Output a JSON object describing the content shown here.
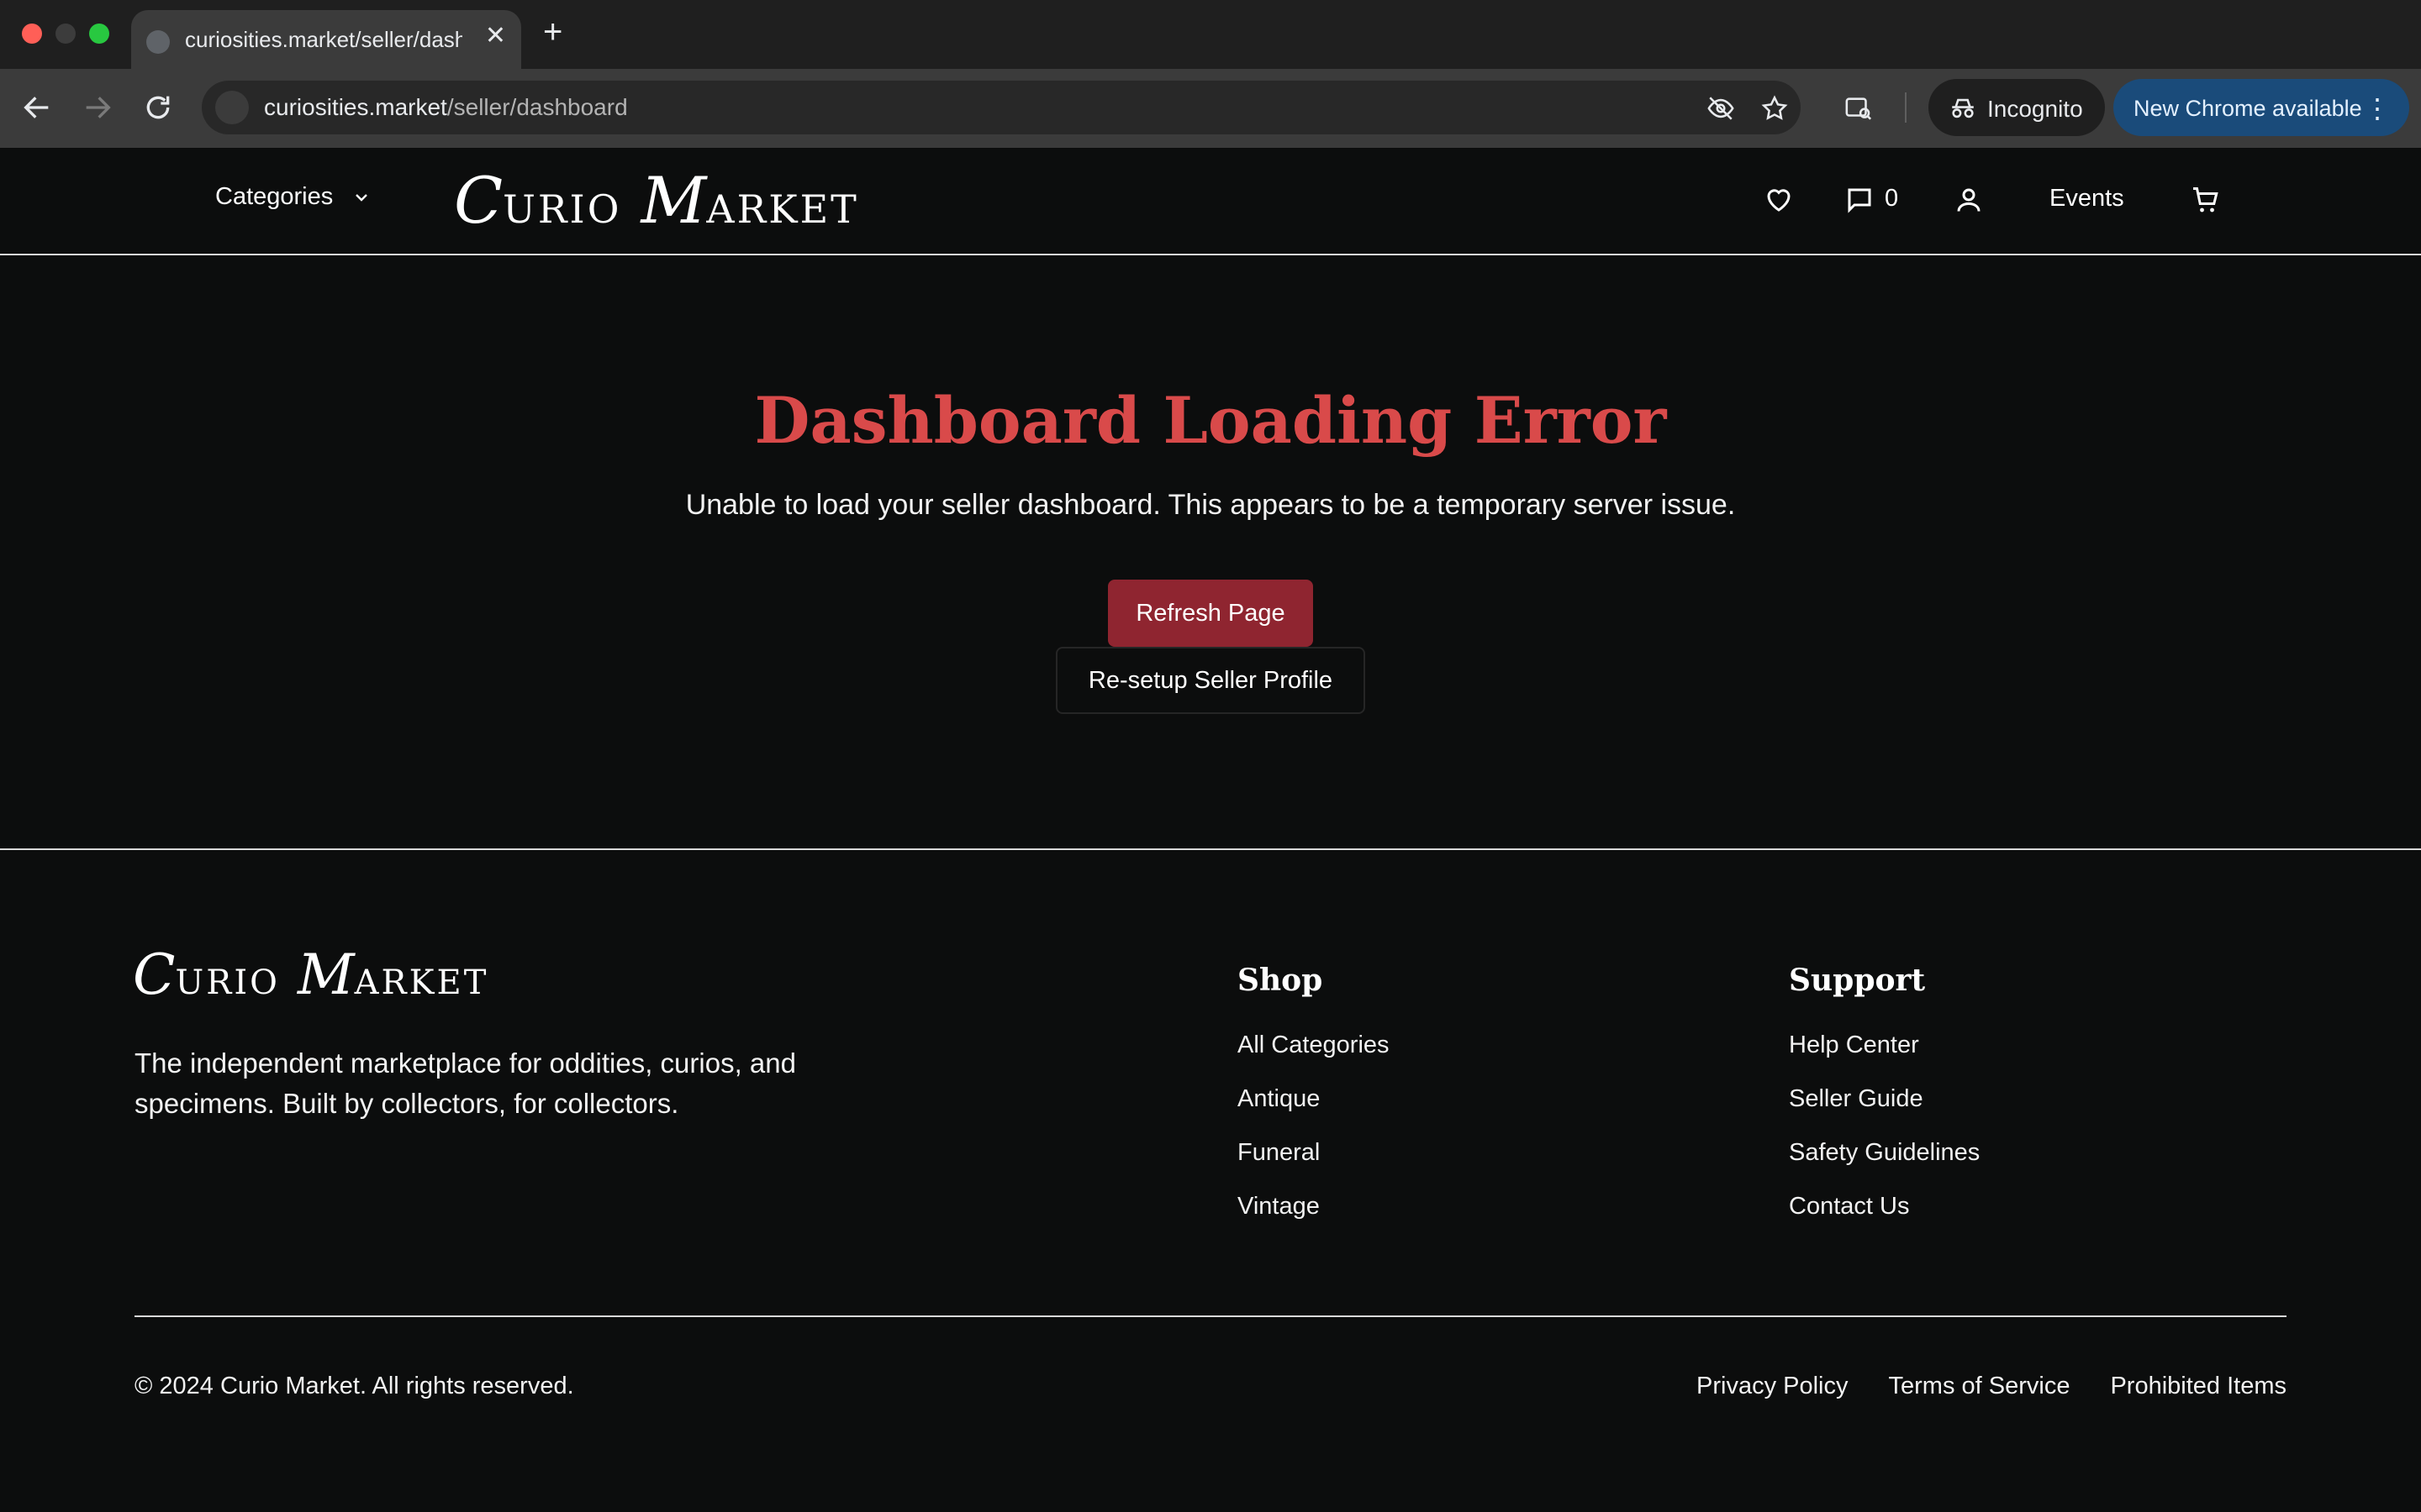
{
  "browser": {
    "tab_title": "curiosities.market/seller/dash",
    "url_host": "curiosities.market",
    "url_path": "/seller/dashboard",
    "incognito_label": "Incognito",
    "update_label": "New Chrome available"
  },
  "header": {
    "categories_label": "Categories",
    "logo_first_cap": "C",
    "logo_first_rest": "URIO",
    "logo_second_cap": "M",
    "logo_second_rest": "ARKET",
    "messages_count": "0",
    "events_label": "Events"
  },
  "error": {
    "title": "Dashboard Loading Error",
    "message": "Unable to load your seller dashboard. This appears to be a temporary server issue.",
    "refresh_label": "Refresh Page",
    "resetup_label": "Re-setup Seller Profile"
  },
  "footer": {
    "tagline": "The independent marketplace for oddities, curios, and specimens. Built by collectors, for collectors.",
    "shop": {
      "heading": "Shop",
      "links": [
        "All Categories",
        "Antique",
        "Funeral",
        "Vintage"
      ]
    },
    "support": {
      "heading": "Support",
      "links": [
        "Help Center",
        "Seller Guide",
        "Safety Guidelines",
        "Contact Us"
      ]
    },
    "copyright": "© 2024 Curio Market. All rights reserved.",
    "legal": [
      "Privacy Policy",
      "Terms of Service",
      "Prohibited Items"
    ]
  },
  "colors": {
    "error_title": "#d94a4a",
    "primary_button": "#8f2530",
    "page_background": "#0c0d0d"
  }
}
